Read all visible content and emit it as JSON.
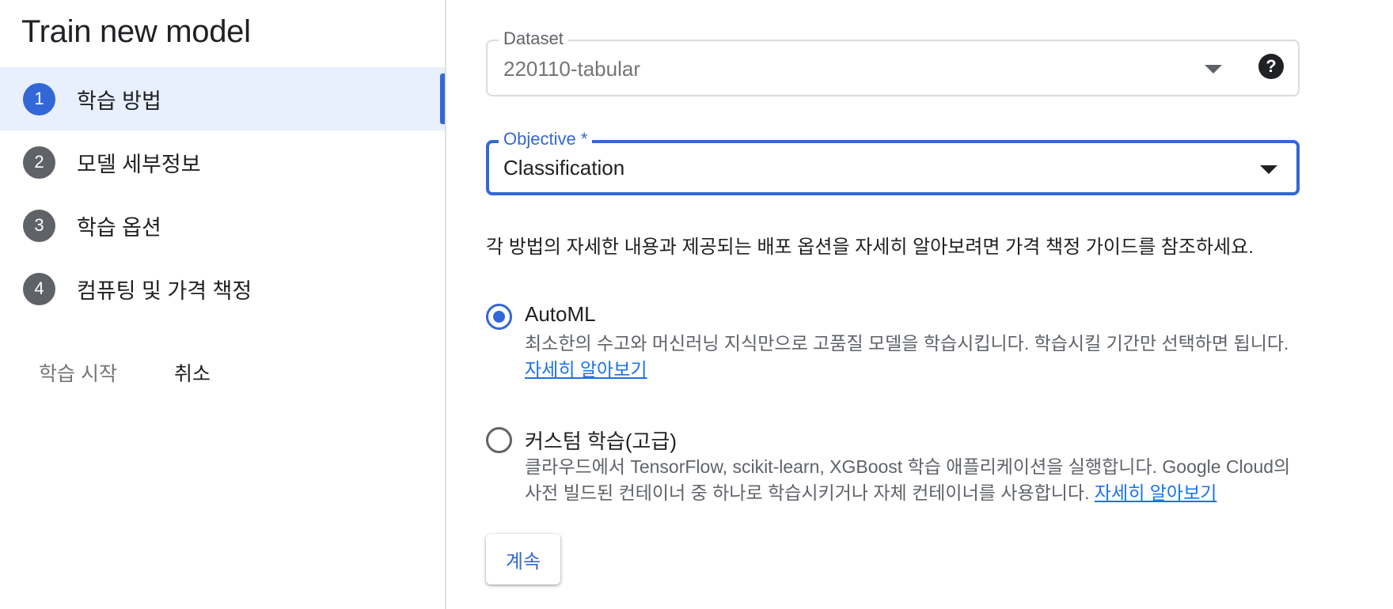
{
  "sidebar": {
    "title": "Train new model",
    "steps": [
      {
        "num": "1",
        "label": "학습 방법"
      },
      {
        "num": "2",
        "label": "모델 세부정보"
      },
      {
        "num": "3",
        "label": "학습 옵션"
      },
      {
        "num": "4",
        "label": "컴퓨팅 및 가격 책정"
      }
    ],
    "start_label": "학습 시작",
    "cancel_label": "취소"
  },
  "main": {
    "dataset": {
      "label": "Dataset",
      "value": "220110-tabular",
      "help": "?"
    },
    "objective": {
      "label": "Objective *",
      "value": "Classification"
    },
    "description": "각 방법의 자세한 내용과 제공되는 배포 옵션을 자세히 알아보려면 가격 책정 가이드를 참조하세요.",
    "options": [
      {
        "label": "AutoML",
        "desc": "최소한의 수고와 머신러닝 지식만으로 고품질 모델을 학습시킵니다. 학습시킬 기간만 선택하면 됩니다.",
        "link": "자세히 알아보기"
      },
      {
        "label": "커스텀 학습(고급)",
        "desc": "클라우드에서 TensorFlow, scikit-learn, XGBoost 학습 애플리케이션을 실행합니다. Google Cloud의 사전 빌드된 컨테이너 중 하나로 학습시키거나 자체 컨테이너를 사용합니다.",
        "link": "자세히 알아보기"
      }
    ],
    "continue_label": "계속"
  },
  "colors": {
    "accent": "#3367d6",
    "active_bg": "#e8f0fe",
    "step_grey": "#5f6368",
    "link": "#1a73e8"
  }
}
